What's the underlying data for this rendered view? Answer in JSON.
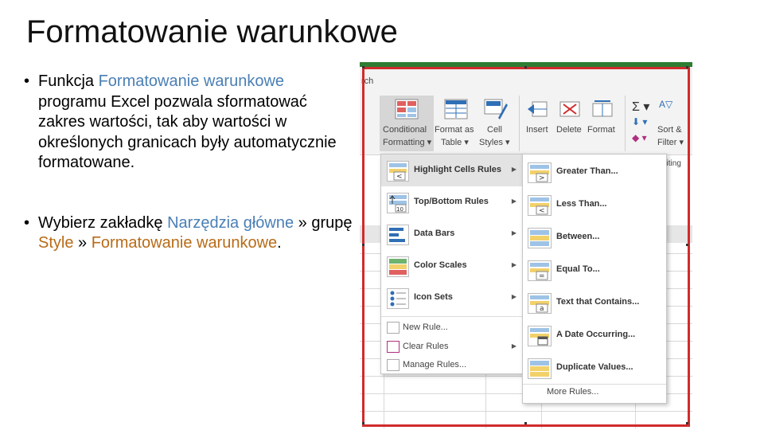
{
  "slide": {
    "title": "Formatowanie warunkowe",
    "bullet1": {
      "prefix": "Funkcja ",
      "highlight": "Formatowanie warunkowe",
      "rest": " programu Excel pozwala sformatować zakres wartości, tak aby wartości w określonych granicach były automatycznie formatowane."
    },
    "bullet2": {
      "p1": "Wybierz zakładkę ",
      "h1": "Narzędzia główne",
      "p2": " » grupę ",
      "h2": "Style",
      "p3": " » ",
      "h3": "Formatowanie warunkowe",
      "p4": "."
    },
    "bullet_glyph": "•"
  },
  "ribbon": {
    "search_fragment": "rch",
    "conditional_formatting": [
      "Conditional",
      "Formatting ▾"
    ],
    "format_as_table": [
      "Format as",
      "Table ▾"
    ],
    "cell_styles": [
      "Cell",
      "Styles ▾"
    ],
    "insert": "Insert",
    "delete": "Delete",
    "format": "Format",
    "sort_filter": [
      "Sort &",
      "Filter ▾"
    ],
    "editing_fragment": "diting"
  },
  "menu_main": {
    "items": [
      {
        "label": "Highlight Cells Rules",
        "icon": "highlight-cells-icon",
        "has_submenu": true
      },
      {
        "label": "Top/Bottom Rules",
        "icon": "top-bottom-icon",
        "has_submenu": true
      },
      {
        "label": "Data Bars",
        "icon": "data-bars-icon",
        "has_submenu": true
      },
      {
        "label": "Color Scales",
        "icon": "color-scales-icon",
        "has_submenu": true
      },
      {
        "label": "Icon Sets",
        "icon": "icon-sets-icon",
        "has_submenu": true
      }
    ],
    "small_items": [
      {
        "label": "New Rule...",
        "icon": "new-rule-icon",
        "has_submenu": false
      },
      {
        "label": "Clear Rules",
        "icon": "clear-rules-icon",
        "has_submenu": true
      },
      {
        "label": "Manage Rules...",
        "icon": "manage-rules-icon",
        "has_submenu": false
      }
    ],
    "submenu_arrow": "▶"
  },
  "menu_sub": {
    "items": [
      {
        "label": "Greater Than...",
        "icon": "greater-than-icon",
        "glyph": ">"
      },
      {
        "label": "Less Than...",
        "icon": "less-than-icon",
        "glyph": "<"
      },
      {
        "label": "Between...",
        "icon": "between-icon",
        "glyph": ""
      },
      {
        "label": "Equal To...",
        "icon": "equal-to-icon",
        "glyph": "="
      },
      {
        "label": "Text that Contains...",
        "icon": "text-contains-icon",
        "glyph": "a"
      },
      {
        "label": "A Date Occurring...",
        "icon": "date-occurring-icon",
        "glyph": ""
      },
      {
        "label": "Duplicate Values...",
        "icon": "duplicate-values-icon",
        "glyph": ""
      }
    ],
    "more": "More Rules..."
  },
  "colors": {
    "accent_blue": "#4a7fb5",
    "accent_orange": "#b86b17",
    "highlight_box": "#d12b2b",
    "selection_top": "#2e7d32"
  }
}
